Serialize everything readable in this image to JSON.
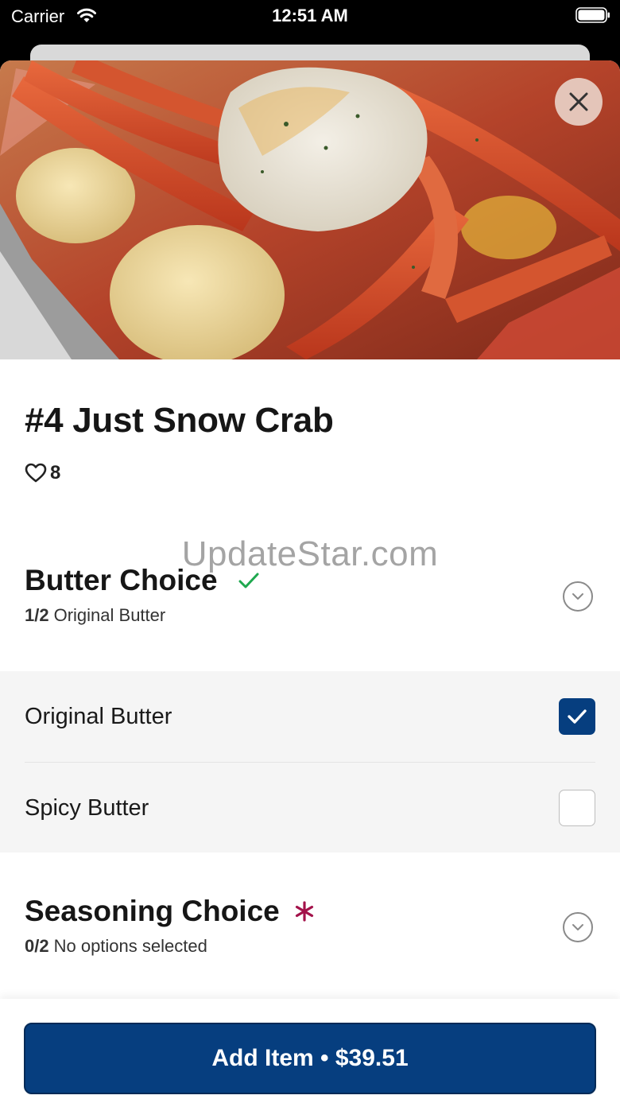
{
  "status_bar": {
    "carrier": "Carrier",
    "time": "12:51 AM"
  },
  "item": {
    "title": "#4 Just Snow Crab",
    "likes": "8",
    "image_alt": "Snow crab legs with potatoes"
  },
  "watermark": "UpdateStar.com",
  "groups": [
    {
      "title": "Butter Choice",
      "count": "1/2",
      "summary": "Original Butter",
      "status": "complete",
      "options": [
        {
          "label": "Original Butter",
          "checked": true
        },
        {
          "label": "Spicy Butter",
          "checked": false
        }
      ]
    },
    {
      "title": "Seasoning Choice",
      "count": "0/2",
      "summary": "No options selected",
      "status": "required"
    }
  ],
  "footer": {
    "add_label": "Add Item • $39.51"
  },
  "colors": {
    "primary": "#063e7f",
    "success": "#1fa84f",
    "required": "#a3124a"
  },
  "icons": [
    "wifi-icon",
    "battery-icon",
    "close-icon",
    "heart-icon",
    "check-icon",
    "chevron-down-icon",
    "required-asterisk-icon"
  ]
}
